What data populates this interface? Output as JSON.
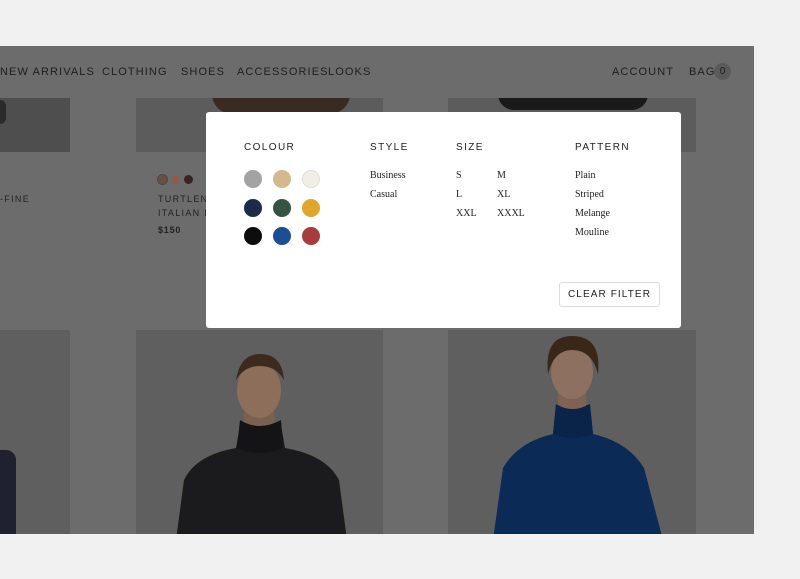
{
  "nav": {
    "items": [
      "NEW ARRIVALS",
      "CLOTHING",
      "SHOES",
      "ACCESSORIES",
      "LOOKS"
    ],
    "account": "ACCOUNT",
    "bag": "BAG",
    "bag_count": "0"
  },
  "products": {
    "left_partial_text": "-FINE",
    "p1_line1": "TURTLENE",
    "p1_line2": "ITALIAN M",
    "p1_price": "$150",
    "swatch_colors": [
      "#6a5042",
      "#8a5e4e",
      "#3a2220"
    ]
  },
  "filter": {
    "colour": {
      "title": "COLOUR",
      "swatches": [
        {
          "name": "grey",
          "color": "#a3a3a3"
        },
        {
          "name": "beige",
          "color": "#d4b98e"
        },
        {
          "name": "off-white",
          "color": "#f0eee6"
        },
        {
          "name": "navy",
          "color": "#1c2b4a"
        },
        {
          "name": "green",
          "color": "#365444"
        },
        {
          "name": "mustard",
          "color": "#e0a52a"
        },
        {
          "name": "black",
          "color": "#0d0d0d"
        },
        {
          "name": "blue",
          "color": "#1c4e94"
        },
        {
          "name": "red",
          "color": "#a83b3e"
        }
      ]
    },
    "style": {
      "title": "STYLE",
      "options": [
        "Business",
        "Casual"
      ]
    },
    "size": {
      "title": "SIZE",
      "options": [
        "S",
        "M",
        "L",
        "XL",
        "XXL",
        "XXXL"
      ]
    },
    "pattern": {
      "title": "PATTERN",
      "options": [
        "Plain",
        "Striped",
        "Melange",
        "Mouline"
      ]
    },
    "clear_label": "CLEAR FILTER"
  }
}
